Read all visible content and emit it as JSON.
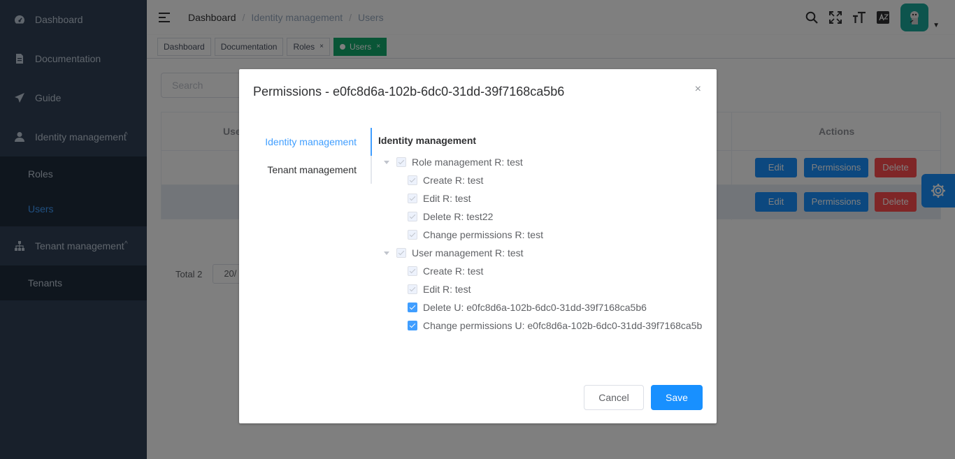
{
  "sidebar": {
    "items": [
      {
        "label": "Dashboard",
        "icon": "dashboard-icon"
      },
      {
        "label": "Documentation",
        "icon": "document-icon"
      },
      {
        "label": "Guide",
        "icon": "guide-icon"
      },
      {
        "label": "Identity management",
        "icon": "user-icon",
        "expanded": true,
        "children": [
          {
            "label": "Roles"
          },
          {
            "label": "Users",
            "active": true
          }
        ]
      },
      {
        "label": "Tenant management",
        "icon": "tree-icon",
        "expanded": true,
        "children": [
          {
            "label": "Tenants"
          }
        ]
      }
    ]
  },
  "header": {
    "breadcrumb": [
      "Dashboard",
      "Identity management",
      "Users"
    ],
    "separator": "/"
  },
  "tags": [
    {
      "label": "Dashboard"
    },
    {
      "label": "Documentation"
    },
    {
      "label": "Roles",
      "closable": true
    },
    {
      "label": "Users",
      "closable": true,
      "active": true
    }
  ],
  "page": {
    "search_placeholder": "Search",
    "table": {
      "columns": [
        "User",
        "Actions"
      ],
      "actions": {
        "edit": "Edit",
        "permissions": "Permissions",
        "delete": "Delete"
      }
    },
    "pagination": {
      "total": "Total 2",
      "page_size": "20/"
    }
  },
  "modal": {
    "title": "Permissions - e0fc8d6a-102b-6dc0-31dd-39f7168ca5b6",
    "close": "×",
    "tabs": [
      "Identity management",
      "Tenant management"
    ],
    "active_tab": "Identity management",
    "pane_title": "Identity management",
    "tree": [
      {
        "label": "Role management R: test",
        "checked": true,
        "disabled": true,
        "children": [
          {
            "label": "Create R: test",
            "checked": true,
            "disabled": true
          },
          {
            "label": "Edit R: test",
            "checked": true,
            "disabled": true
          },
          {
            "label": "Delete R: test22",
            "checked": true,
            "disabled": true
          },
          {
            "label": "Change permissions R: test",
            "checked": true,
            "disabled": true
          }
        ]
      },
      {
        "label": "User management R: test",
        "checked": true,
        "disabled": true,
        "children": [
          {
            "label": "Create R: test",
            "checked": true,
            "disabled": true
          },
          {
            "label": "Edit R: test",
            "checked": true,
            "disabled": true
          },
          {
            "label": "Delete U: e0fc8d6a-102b-6dc0-31dd-39f7168ca5b6",
            "checked": true,
            "disabled": false
          },
          {
            "label": "Change permissions U: e0fc8d6a-102b-6dc0-31dd-39f7168ca5b",
            "checked": true,
            "disabled": false
          }
        ]
      }
    ],
    "cancel_label": "Cancel",
    "save_label": "Save"
  },
  "colors": {
    "sidebar_bg": "#304156",
    "accent": "#1890ff",
    "active_tag": "#13ab6c",
    "danger": "#ff4d4f"
  }
}
